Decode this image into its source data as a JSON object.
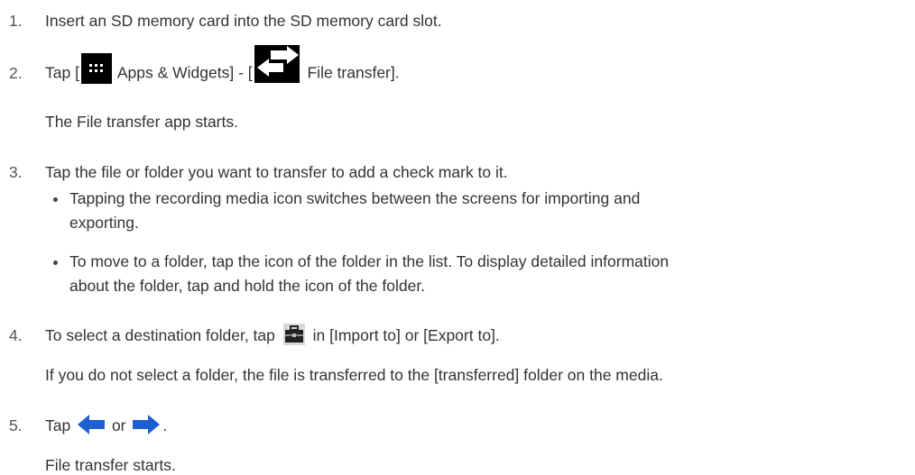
{
  "steps": [
    {
      "number": "1.",
      "text": "Insert an SD memory card into the SD memory card slot."
    },
    {
      "number": "2.",
      "pre": "Tap [",
      "apps_label": " Apps & Widgets] - [",
      "ft_label": " File transfer].",
      "note": "The File transfer app starts."
    },
    {
      "number": "3.",
      "text": "Tap the file or folder you want to transfer to add a check mark to it.",
      "bullets": [
        {
          "line1": "Tapping the recording media icon switches between the screens for importing and",
          "line2": "exporting."
        },
        {
          "line1": "To move to a folder, tap the icon of the folder in the list. To display detailed information",
          "line2": "about the folder, tap and hold the icon of the folder."
        }
      ]
    },
    {
      "number": "4.",
      "pre": "To select a destination folder, tap ",
      "post": " in [Import to] or [Export to].",
      "note": "If you do not select a folder, the file is transferred to the [transferred] folder on the media."
    },
    {
      "number": "5.",
      "pre": "Tap ",
      "mid": " or ",
      "post": ".",
      "note": "File transfer starts."
    }
  ],
  "icons": {
    "apps": "apps-grid-icon",
    "file_transfer": "file-transfer-icon",
    "toolbox": "toolbox-icon",
    "import_arrow": "left-arrow-icon",
    "export_arrow": "right-arrow-icon",
    "arrow_color": "#1E5FD0"
  }
}
